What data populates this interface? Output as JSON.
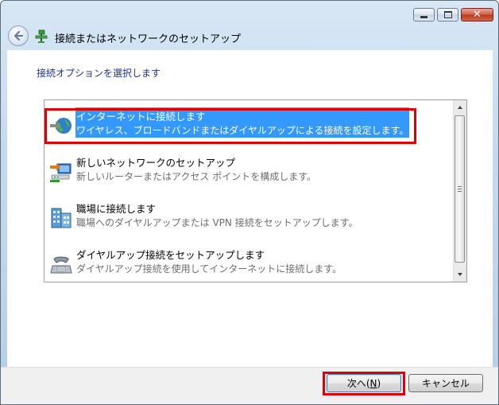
{
  "window": {
    "controls": {
      "minimize": "minimize",
      "maximize": "maximize",
      "close": "close"
    }
  },
  "header": {
    "title": "接続またはネットワークのセットアップ",
    "back_icon": "back-arrow-icon",
    "title_icon": "network-setup-icon"
  },
  "main": {
    "instruction": "接続オプションを選択します",
    "options": [
      {
        "title": "インターネットに接続します",
        "desc": "ワイヤレス、ブロードバンドまたはダイヤルアップによる接続を設定します。",
        "icon": "globe-network-icon",
        "selected": true
      },
      {
        "title": "新しいネットワークのセットアップ",
        "desc": "新しいルーターまたはアクセス ポイントを構成します。",
        "icon": "router-icon",
        "selected": false
      },
      {
        "title": "職場に接続します",
        "desc": "職場へのダイヤルアップまたは VPN 接続をセットアップします。",
        "icon": "workplace-icon",
        "selected": false
      },
      {
        "title": "ダイヤルアップ接続をセットアップします",
        "desc": "ダイヤルアップ接続を使用してインターネットに接続します。",
        "icon": "phone-modem-icon",
        "selected": false
      }
    ]
  },
  "footer": {
    "next_label": "次へ(",
    "next_accel": "N",
    "next_close": ")",
    "cancel_label": "キャンセル"
  },
  "colors": {
    "selection": "#3399ff",
    "highlight": "#e00000",
    "instruction": "#1e3287"
  }
}
